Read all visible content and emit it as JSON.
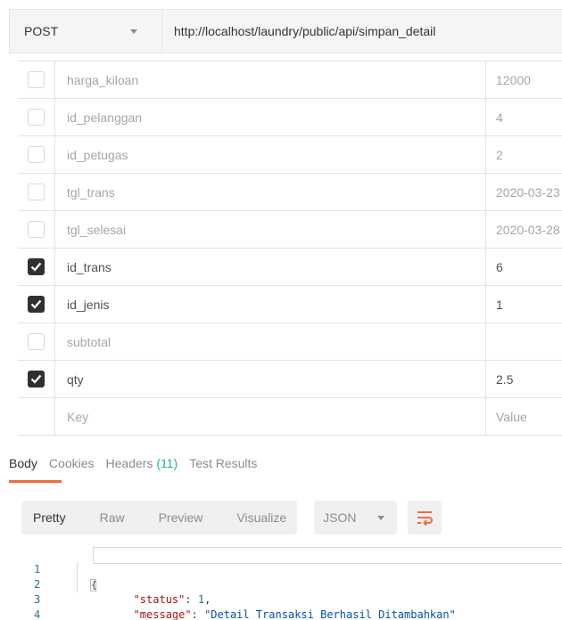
{
  "request": {
    "method": "POST",
    "url": "http://localhost/laundry/public/api/simpan_detail"
  },
  "params": {
    "rows": [
      {
        "key": "harga_kiloan",
        "value": "12000",
        "checked": false
      },
      {
        "key": "id_pelanggan",
        "value": "4",
        "checked": false
      },
      {
        "key": "id_petugas",
        "value": "2",
        "checked": false
      },
      {
        "key": "tgl_trans",
        "value": "2020-03-23",
        "checked": false
      },
      {
        "key": "tgl_selesai",
        "value": "2020-03-28",
        "checked": false
      },
      {
        "key": "id_trans",
        "value": "6",
        "checked": true
      },
      {
        "key": "id_jenis",
        "value": "1",
        "checked": true
      },
      {
        "key": "subtotal",
        "value": "",
        "checked": false
      },
      {
        "key": "qty",
        "value": "2.5",
        "checked": true
      }
    ],
    "placeholder": {
      "key": "Key",
      "value": "Value"
    }
  },
  "response": {
    "tabs": [
      {
        "label": "Body",
        "active": true
      },
      {
        "label": "Cookies",
        "active": false
      },
      {
        "label": "Headers",
        "count": "(11)",
        "active": false
      },
      {
        "label": "Test Results",
        "active": false
      }
    ],
    "modes": [
      {
        "label": "Pretty",
        "active": true
      },
      {
        "label": "Raw",
        "active": false
      },
      {
        "label": "Preview",
        "active": false
      },
      {
        "label": "Visualize",
        "active": false
      }
    ],
    "format": "JSON",
    "accent_color": "#f26b3a",
    "wrap_icon": "wrap-lines-icon"
  },
  "code": {
    "line_numbers": [
      "1",
      "2",
      "3",
      "4"
    ],
    "open_brace": "{",
    "close_brace": "}",
    "status_key": "\"status\"",
    "status_value": "1",
    "message_key": "\"message\"",
    "message_value": "\"Detail Transaksi Berhasil Ditambahkan\""
  }
}
